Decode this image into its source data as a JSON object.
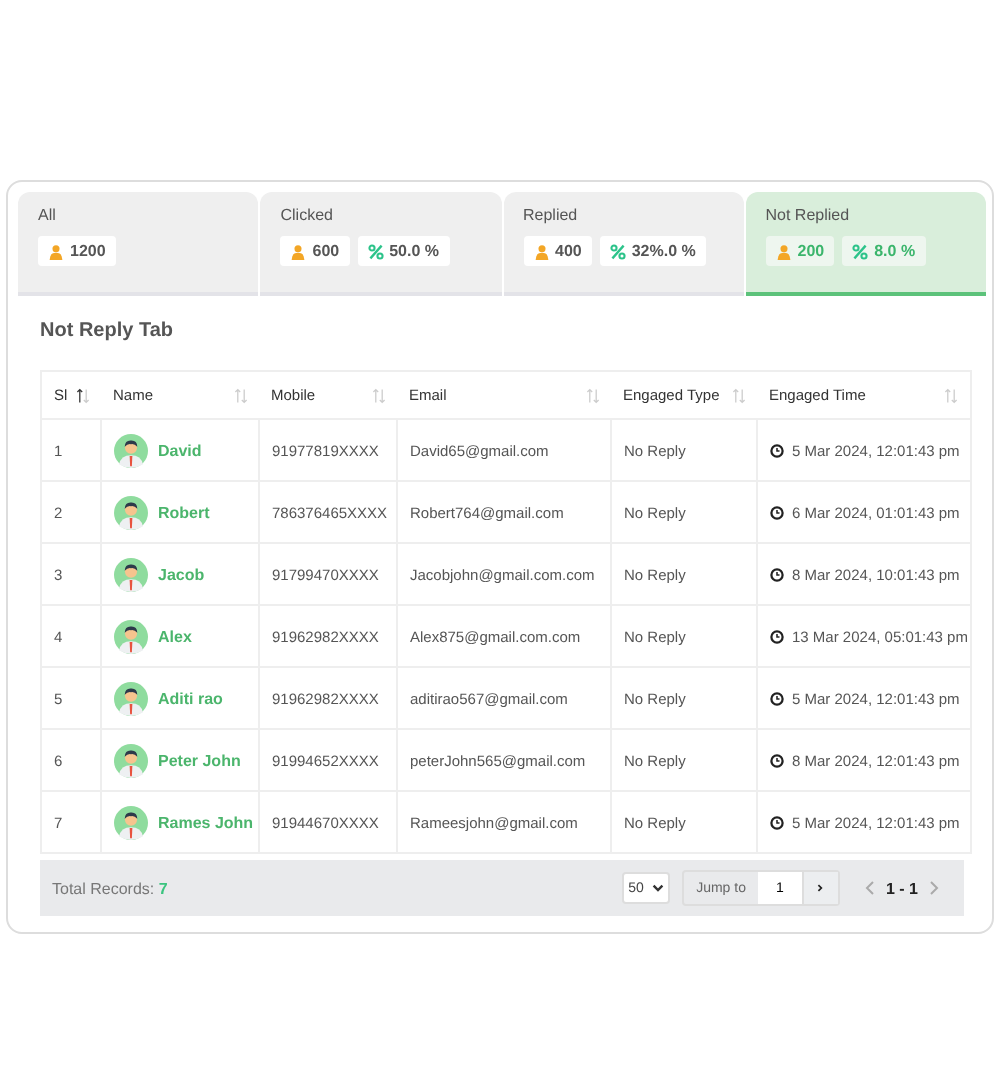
{
  "tabs": [
    {
      "label": "All",
      "count": "1200",
      "selected": false
    },
    {
      "label": "Clicked",
      "count": "600",
      "percent": "50.0 %",
      "selected": false
    },
    {
      "label": "Replied",
      "count": "400",
      "percent": "32%.0 %",
      "selected": false
    },
    {
      "label": "Not Replied",
      "count": "200",
      "percent": "8.0 %",
      "selected": true
    }
  ],
  "panel_title": "Not Reply Tab",
  "table": {
    "columns": [
      {
        "label": "Sl",
        "sorted": true
      },
      {
        "label": "Name",
        "sorted": false
      },
      {
        "label": "Mobile",
        "sorted": false
      },
      {
        "label": "Email",
        "sorted": false
      },
      {
        "label": "Engaged Type",
        "sorted": false
      },
      {
        "label": "Engaged Time",
        "sorted": false
      }
    ],
    "rows": [
      {
        "sl": "1",
        "name": "David",
        "mobile": "91977819XXXX",
        "email": "David65@gmail.com",
        "type": "No Reply",
        "time": "5 Mar 2024, 12:01:43 pm"
      },
      {
        "sl": "2",
        "name": "Robert",
        "mobile": "786376465XXXX",
        "email": "Robert764@gmail.com",
        "type": "No Reply",
        "time": "6 Mar 2024, 01:01:43 pm"
      },
      {
        "sl": "3",
        "name": "Jacob",
        "mobile": "91799470XXXX",
        "email": "Jacobjohn@gmail.com.com",
        "type": "No Reply",
        "time": "8 Mar 2024, 10:01:43 pm"
      },
      {
        "sl": "4",
        "name": "Alex",
        "mobile": "91962982XXXX",
        "email": "Alex875@gmail.com.com",
        "type": "No Reply",
        "time": "13 Mar 2024, 05:01:43 pm"
      },
      {
        "sl": "5",
        "name": "Aditi rao",
        "mobile": "91962982XXXX",
        "email": "aditirao567@gmail.com",
        "type": "No Reply",
        "time": "5 Mar 2024, 12:01:43 pm"
      },
      {
        "sl": "6",
        "name": "Peter John",
        "mobile": "91994652XXXX",
        "email": "peterJohn565@gmail.com",
        "type": "No Reply",
        "time": "8 Mar 2024, 12:01:43 pm"
      },
      {
        "sl": "7",
        "name": "Rames John",
        "mobile": "91944670XXXX",
        "email": "Rameesjohn@gmail.com",
        "type": "No Reply",
        "time": "5 Mar 2024, 12:01:43 pm"
      }
    ]
  },
  "footer": {
    "total_label": "Total Records:",
    "total": "7",
    "page_size": "50",
    "jump_label": "Jump to",
    "jump_value": "1",
    "range": "1 - 1"
  }
}
